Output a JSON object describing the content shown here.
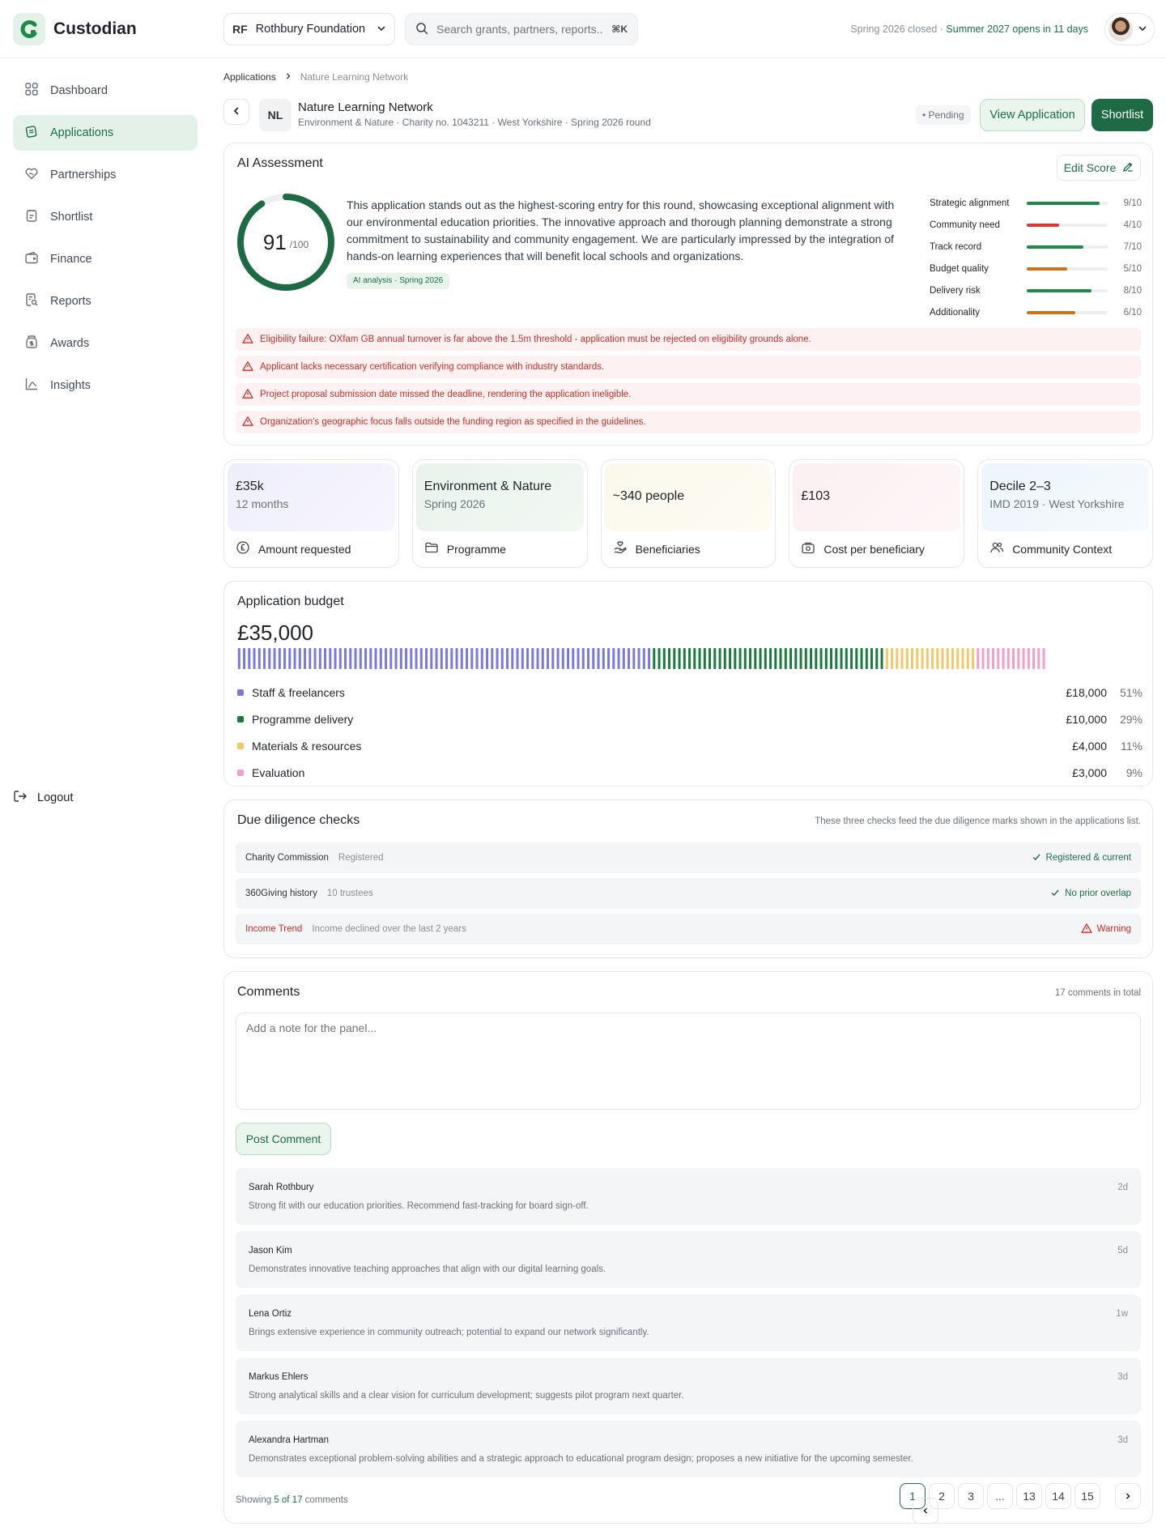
{
  "brand": {
    "name": "Custodian"
  },
  "header": {
    "org_badge": "RF",
    "org_name": "Rothbury Foundation",
    "search_placeholder": "Search grants, partners, reports...",
    "search_shortcut": "⌘K",
    "round_closed": "Spring 2026 closed · ",
    "round_opens": "Summer 2027 opens in 11 days"
  },
  "sidebar": {
    "items": [
      {
        "label": "Dashboard",
        "icon": "grid-icon"
      },
      {
        "label": "Applications",
        "icon": "applications-icon",
        "active": true
      },
      {
        "label": "Partnerships",
        "icon": "handshake-heart-icon"
      },
      {
        "label": "Shortlist",
        "icon": "clipboard-icon"
      },
      {
        "label": "Finance",
        "icon": "wallet-icon"
      },
      {
        "label": "Reports",
        "icon": "report-search-icon"
      },
      {
        "label": "Awards",
        "icon": "money-jar-icon"
      },
      {
        "label": "Insights",
        "icon": "chart-icon"
      }
    ],
    "logout": "Logout"
  },
  "breadcrumb": {
    "parent": "Applications",
    "current": "Nature Learning Network"
  },
  "application": {
    "initials": "NL",
    "title": "Nature Learning Network",
    "subtitle": "Environment & Nature · Charity no. 1043211 · West Yorkshire · Spring 2026 round",
    "status": "• Pending",
    "view_label": "View Application",
    "shortlist_label": "Shortlist"
  },
  "ai": {
    "title": "AI Assessment",
    "edit_label": "Edit Score",
    "score": "91",
    "score_max": "/100",
    "score_value": 91,
    "summary": "This application stands out as the highest-scoring entry for this round, showcasing exceptional alignment with our environmental education priorities. The innovative approach and thorough planning demonstrate a strong commitment to sustainability and community engagement. We are particularly impressed by the integration of hands-on learning experiences that will benefit local schools and organizations.",
    "tag": "AI analysis · Spring 2026",
    "metrics": [
      {
        "label": "Strategic alignment",
        "value": "9/10",
        "score": 9,
        "color": "#1e8a4a"
      },
      {
        "label": "Community need",
        "value": "4/10",
        "score": 4,
        "color": "#d93a33"
      },
      {
        "label": "Track record",
        "value": "7/10",
        "score": 7,
        "color": "#1e8a4a"
      },
      {
        "label": "Budget quality",
        "value": "5/10",
        "score": 5,
        "color": "#c8741a"
      },
      {
        "label": "Delivery risk",
        "value": "8/10",
        "score": 8,
        "color": "#1e8a4a"
      },
      {
        "label": "Additionality",
        "value": "6/10",
        "score": 6,
        "color": "#c8741a"
      }
    ],
    "alerts": [
      "Eligibility failure: OXfam GB annual turnover is far above the 1.5m threshold - application must be rejected on eligibility grounds alone.",
      "Applicant lacks necessary certification verifying compliance with industry standards.",
      "Project proposal submission date missed the deadline, rendering the application ineligible.",
      "Organization's geographic focus falls outside the funding region as specified in the guidelines."
    ]
  },
  "tiles": [
    {
      "value": "£35k",
      "sub": "12 months",
      "label": "Amount requested",
      "icon": "pound-coin-icon"
    },
    {
      "value": "Environment & Nature",
      "sub": "Spring 2026",
      "label": "Programme",
      "icon": "folder-icon"
    },
    {
      "value": "~340 people",
      "sub": "",
      "label": "Beneficiaries",
      "icon": "hand-heart-icon"
    },
    {
      "value": "£103",
      "sub": "",
      "label": "Cost per beneficiary",
      "icon": "cost-icon"
    },
    {
      "value": "Decile 2–3",
      "sub": "IMD 2019 · West Yorkshire",
      "label": "Community Context",
      "icon": "people-icon"
    }
  ],
  "budget": {
    "title": "Application budget",
    "total": "£35,000",
    "rows": [
      {
        "label": "Staff & freelancers",
        "amount": "£18,000",
        "pct": "51%",
        "share": 51,
        "color": "#7b78e0"
      },
      {
        "label": "Programme delivery",
        "amount": "£10,000",
        "pct": "29%",
        "share": 29,
        "color": "#1b7a3e"
      },
      {
        "label": "Materials & resources",
        "amount": "£4,000",
        "pct": "11%",
        "share": 11,
        "color": "#f3c76a"
      },
      {
        "label": "Evaluation",
        "amount": "£3,000",
        "pct": "9%",
        "share": 9,
        "color": "#f0a0c8"
      }
    ]
  },
  "due_diligence": {
    "title": "Due diligence checks",
    "note": "These three checks feed the due diligence marks shown in the applications list.",
    "rows": [
      {
        "name": "Charity Commission",
        "detail": "Registered",
        "status": "Registered & current",
        "warn": false
      },
      {
        "name": "360Giving history",
        "detail": "10 trustees",
        "status": "No prior overlap",
        "warn": false
      },
      {
        "name": "Income Trend",
        "detail": "Income declined over the last 2 years",
        "status": "Warning",
        "warn": true
      }
    ]
  },
  "comments": {
    "title": "Comments",
    "count": "17 comments in total",
    "placeholder": "Add a note for the panel...",
    "post_label": "Post Comment",
    "items": [
      {
        "author": "Sarah Rothbury",
        "time": "2d",
        "text": "Strong fit with our education priorities. Recommend fast-tracking for board sign-off."
      },
      {
        "author": "Jason Kim",
        "time": "5d",
        "text": "Demonstrates innovative teaching approaches that align with our digital learning goals."
      },
      {
        "author": "Lena Ortiz",
        "time": "1w",
        "text": "Brings extensive experience in community outreach; potential to expand our network significantly."
      },
      {
        "author": "Markus Ehlers",
        "time": "3d",
        "text": "Strong analytical skills and a clear vision for curriculum development; suggests pilot program next quarter."
      },
      {
        "author": "Alexandra Hartman",
        "time": "3d",
        "text": "Demonstrates exceptional problem-solving abilities and a strategic approach to educational program design; proposes a new initiative for the upcoming semester."
      }
    ],
    "showing_prefix": "Showing ",
    "showing_range": "5 of 17",
    "showing_suffix": " comments",
    "pages": [
      "1",
      "2",
      "3",
      "...",
      "13",
      "14",
      "15"
    ],
    "current_page": "1"
  }
}
